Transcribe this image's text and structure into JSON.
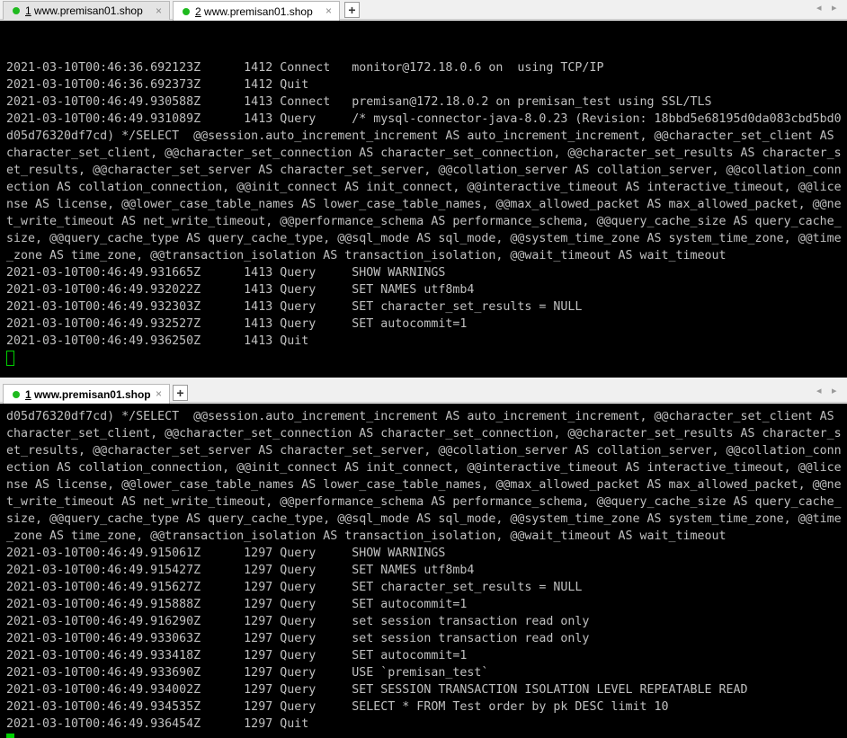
{
  "top_pane": {
    "tabs": [
      {
        "number": "1",
        "title": " www.premisan01.shop",
        "close": "×"
      },
      {
        "number": "2",
        "title": " www.premisan01.shop",
        "close": "×"
      }
    ],
    "new_tab": "+",
    "nav_left": "◂",
    "nav_right": "▸",
    "lines": [
      "",
      "",
      "2021-03-10T00:46:36.692123Z      1412 Connect   monitor@172.18.0.6 on  using TCP/IP",
      "2021-03-10T00:46:36.692373Z      1412 Quit",
      "2021-03-10T00:46:49.930588Z      1413 Connect   premisan@172.18.0.2 on premisan_test using SSL/TLS",
      "2021-03-10T00:46:49.931089Z      1413 Query     /* mysql-connector-java-8.0.23 (Revision: 18bbd5e68195d0da083cbd5bd0",
      "d05d76320df7cd) */SELECT  @@session.auto_increment_increment AS auto_increment_increment, @@character_set_client AS",
      "character_set_client, @@character_set_connection AS character_set_connection, @@character_set_results AS character_s",
      "et_results, @@character_set_server AS character_set_server, @@collation_server AS collation_server, @@collation_conn",
      "ection AS collation_connection, @@init_connect AS init_connect, @@interactive_timeout AS interactive_timeout, @@lice",
      "nse AS license, @@lower_case_table_names AS lower_case_table_names, @@max_allowed_packet AS max_allowed_packet, @@ne",
      "t_write_timeout AS net_write_timeout, @@performance_schema AS performance_schema, @@query_cache_size AS query_cache_",
      "size, @@query_cache_type AS query_cache_type, @@sql_mode AS sql_mode, @@system_time_zone AS system_time_zone, @@time",
      "_zone AS time_zone, @@transaction_isolation AS transaction_isolation, @@wait_timeout AS wait_timeout",
      "2021-03-10T00:46:49.931665Z      1413 Query     SHOW WARNINGS",
      "2021-03-10T00:46:49.932022Z      1413 Query     SET NAMES utf8mb4",
      "2021-03-10T00:46:49.932303Z      1413 Query     SET character_set_results = NULL",
      "2021-03-10T00:46:49.932527Z      1413 Query     SET autocommit=1",
      "2021-03-10T00:46:49.936250Z      1413 Quit"
    ]
  },
  "bottom_pane": {
    "tabs": [
      {
        "number": "1",
        "title": " www.premisan01.shop",
        "close": "×"
      }
    ],
    "new_tab": "+",
    "nav_left": "◂",
    "nav_right": "▸",
    "lines": [
      "d05d76320df7cd) */SELECT  @@session.auto_increment_increment AS auto_increment_increment, @@character_set_client AS",
      "character_set_client, @@character_set_connection AS character_set_connection, @@character_set_results AS character_s",
      "et_results, @@character_set_server AS character_set_server, @@collation_server AS collation_server, @@collation_conn",
      "ection AS collation_connection, @@init_connect AS init_connect, @@interactive_timeout AS interactive_timeout, @@lice",
      "nse AS license, @@lower_case_table_names AS lower_case_table_names, @@max_allowed_packet AS max_allowed_packet, @@ne",
      "t_write_timeout AS net_write_timeout, @@performance_schema AS performance_schema, @@query_cache_size AS query_cache_",
      "size, @@query_cache_type AS query_cache_type, @@sql_mode AS sql_mode, @@system_time_zone AS system_time_zone, @@time",
      "_zone AS time_zone, @@transaction_isolation AS transaction_isolation, @@wait_timeout AS wait_timeout",
      "2021-03-10T00:46:49.915061Z      1297 Query     SHOW WARNINGS",
      "2021-03-10T00:46:49.915427Z      1297 Query     SET NAMES utf8mb4",
      "2021-03-10T00:46:49.915627Z      1297 Query     SET character_set_results = NULL",
      "2021-03-10T00:46:49.915888Z      1297 Query     SET autocommit=1",
      "2021-03-10T00:46:49.916290Z      1297 Query     set session transaction read only",
      "2021-03-10T00:46:49.933063Z      1297 Query     set session transaction read only",
      "2021-03-10T00:46:49.933418Z      1297 Query     SET autocommit=1",
      "2021-03-10T00:46:49.933690Z      1297 Query     USE `premisan_test`",
      "2021-03-10T00:46:49.934002Z      1297 Query     SET SESSION TRANSACTION ISOLATION LEVEL REPEATABLE READ",
      "2021-03-10T00:46:49.934535Z      1297 Query     SELECT * FROM Test order by pk DESC limit 10",
      "2021-03-10T00:46:49.936454Z      1297 Quit"
    ]
  },
  "colors": {
    "terminal_bg": "#000000",
    "terminal_fg": "#c0c0c0",
    "cursor": "#00d000",
    "tab_dot": "#1fba1f"
  }
}
